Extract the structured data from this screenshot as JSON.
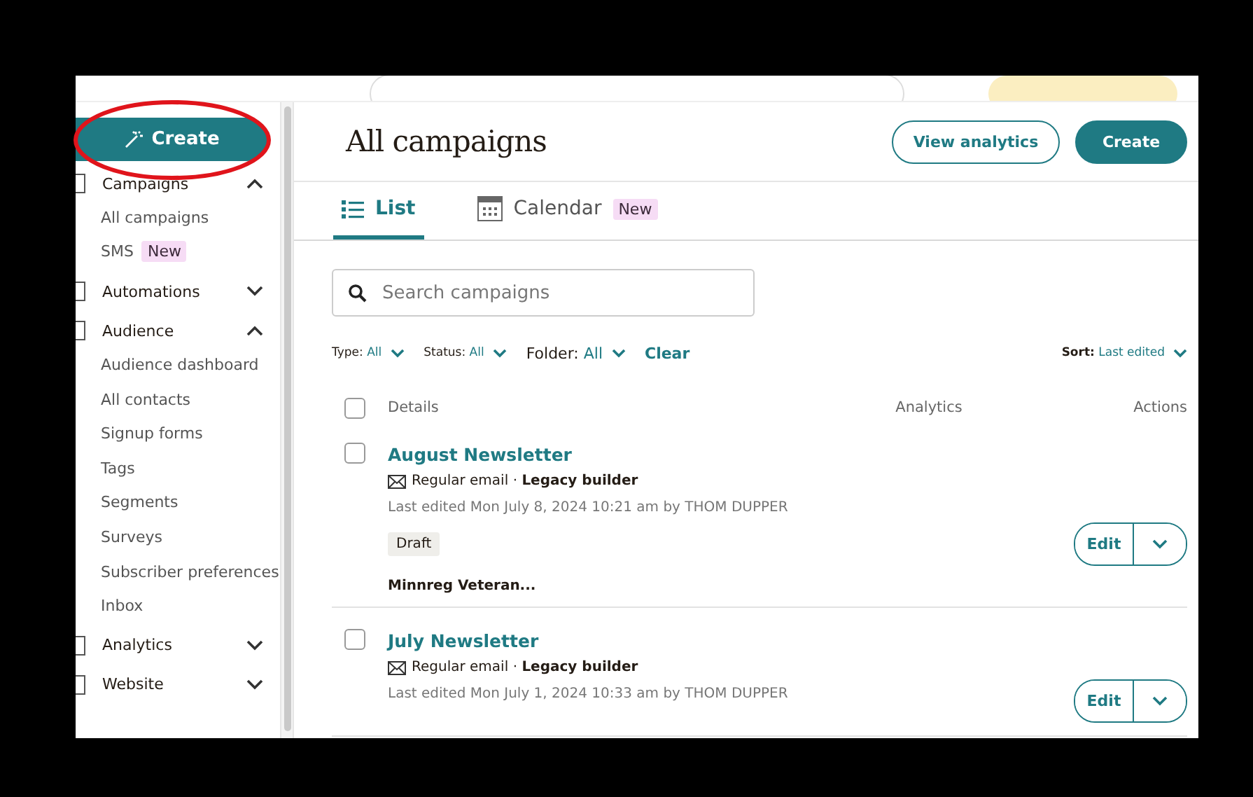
{
  "sidebar": {
    "create_button": {
      "label": "Create",
      "highlighted": true
    },
    "sections": [
      {
        "label": "Campaigns",
        "expanded": true,
        "children": [
          {
            "label": "All campaigns"
          },
          {
            "label": "SMS",
            "badge": "New"
          }
        ]
      },
      {
        "label": "Automations",
        "expanded": false
      },
      {
        "label": "Audience",
        "expanded": true,
        "children": [
          {
            "label": "Audience dashboard"
          },
          {
            "label": "All contacts"
          },
          {
            "label": "Signup forms"
          },
          {
            "label": "Tags"
          },
          {
            "label": "Segments"
          },
          {
            "label": "Surveys"
          },
          {
            "label": "Subscriber preferences"
          },
          {
            "label": "Inbox"
          }
        ]
      },
      {
        "label": "Analytics",
        "expanded": false
      },
      {
        "label": "Website",
        "expanded": false
      }
    ]
  },
  "header": {
    "title": "All campaigns",
    "buttons": [
      {
        "label": "View analytics",
        "kind": "outline"
      },
      {
        "label": "Create",
        "kind": "primary"
      }
    ]
  },
  "tabs": [
    {
      "label": "List",
      "selected": true
    },
    {
      "label": "Calendar",
      "selected": false,
      "badge": "New"
    }
  ],
  "search": {
    "placeholder": "Search campaigns"
  },
  "filters": [
    {
      "label": "Type:",
      "value": "All"
    },
    {
      "label": "Status:",
      "value": "All"
    },
    {
      "label": "Folder:",
      "value": "All"
    }
  ],
  "clear_link": "Clear",
  "sort": {
    "label": "Sort:",
    "value": "Last edited"
  },
  "table": {
    "select_all_checked": false,
    "columns": [
      "Details",
      "Analytics",
      "Actions"
    ],
    "rows": [
      {
        "title": "August Newsletter",
        "type": "Regular email",
        "separator": "·",
        "builder": "Legacy builder",
        "edited": "Last edited Mon July 8, 2024 10:21 am by THOM DUPPER",
        "status": "Draft",
        "audience": "Minnreg Veteran...",
        "action": "Edit",
        "checked": false
      },
      {
        "title": "July Newsletter",
        "type": "Regular email",
        "separator": "·",
        "builder": "Legacy builder",
        "edited": "Last edited Mon July 1, 2024 10:33 am by THOM DUPPER",
        "action": "Edit",
        "checked": false
      }
    ]
  }
}
